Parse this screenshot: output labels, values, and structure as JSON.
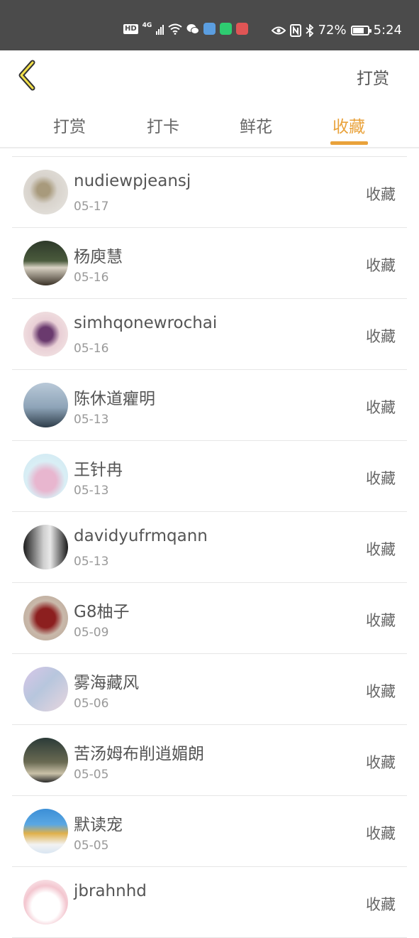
{
  "status_bar": {
    "left_icons": [
      "hd-icon",
      "4g-signal-icon",
      "wifi-icon",
      "wechat-icon",
      "app-blue-icon",
      "app-green-chat-icon",
      "app-red-icon"
    ],
    "battery_percent": "72%",
    "battery_level": 0.72,
    "time": "5:24"
  },
  "header": {
    "back_icon": "chevron-left-icon",
    "right_link": "打赏"
  },
  "tabs": [
    {
      "label": "打赏",
      "active": false
    },
    {
      "label": "打卡",
      "active": false
    },
    {
      "label": "鲜花",
      "active": false
    },
    {
      "label": "收藏",
      "active": true
    }
  ],
  "colors": {
    "accent": "#e9a23b",
    "status_bar_bg": "#4b4b4b"
  },
  "items": [
    {
      "name": "nudiewpjeansj",
      "date": "05-17",
      "action": "收藏"
    },
    {
      "name": "杨庾慧",
      "date": "05-16",
      "action": "收藏"
    },
    {
      "name": "simhqonewrochai",
      "date": "05-16",
      "action": "收藏"
    },
    {
      "name": "陈休道癯明",
      "date": "05-13",
      "action": "收藏"
    },
    {
      "name": "王针冉",
      "date": "05-13",
      "action": "收藏"
    },
    {
      "name": "davidyufrmqann",
      "date": "05-13",
      "action": "收藏"
    },
    {
      "name": "G8柚子",
      "date": "05-09",
      "action": "收藏"
    },
    {
      "name": "雾海藏风",
      "date": "05-06",
      "action": "收藏"
    },
    {
      "name": "苦汤姆布削逍媚朗",
      "date": "05-05",
      "action": "收藏"
    },
    {
      "name": "默读宠",
      "date": "05-05",
      "action": "收藏"
    },
    {
      "name": "jbrahnhd",
      "date": "",
      "action": "收藏"
    }
  ]
}
